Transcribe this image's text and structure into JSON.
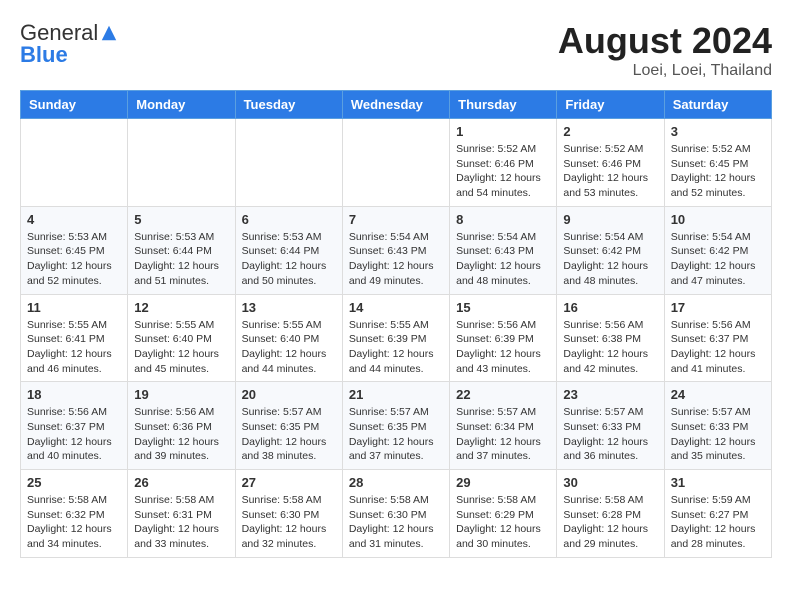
{
  "header": {
    "logo_general": "General",
    "logo_blue": "Blue",
    "title": "August 2024",
    "location": "Loei, Loei, Thailand"
  },
  "days_of_week": [
    "Sunday",
    "Monday",
    "Tuesday",
    "Wednesday",
    "Thursday",
    "Friday",
    "Saturday"
  ],
  "weeks": [
    [
      {
        "day": "",
        "info": ""
      },
      {
        "day": "",
        "info": ""
      },
      {
        "day": "",
        "info": ""
      },
      {
        "day": "",
        "info": ""
      },
      {
        "day": "1",
        "info": "Sunrise: 5:52 AM\nSunset: 6:46 PM\nDaylight: 12 hours\nand 54 minutes."
      },
      {
        "day": "2",
        "info": "Sunrise: 5:52 AM\nSunset: 6:46 PM\nDaylight: 12 hours\nand 53 minutes."
      },
      {
        "day": "3",
        "info": "Sunrise: 5:52 AM\nSunset: 6:45 PM\nDaylight: 12 hours\nand 52 minutes."
      }
    ],
    [
      {
        "day": "4",
        "info": "Sunrise: 5:53 AM\nSunset: 6:45 PM\nDaylight: 12 hours\nand 52 minutes."
      },
      {
        "day": "5",
        "info": "Sunrise: 5:53 AM\nSunset: 6:44 PM\nDaylight: 12 hours\nand 51 minutes."
      },
      {
        "day": "6",
        "info": "Sunrise: 5:53 AM\nSunset: 6:44 PM\nDaylight: 12 hours\nand 50 minutes."
      },
      {
        "day": "7",
        "info": "Sunrise: 5:54 AM\nSunset: 6:43 PM\nDaylight: 12 hours\nand 49 minutes."
      },
      {
        "day": "8",
        "info": "Sunrise: 5:54 AM\nSunset: 6:43 PM\nDaylight: 12 hours\nand 48 minutes."
      },
      {
        "day": "9",
        "info": "Sunrise: 5:54 AM\nSunset: 6:42 PM\nDaylight: 12 hours\nand 48 minutes."
      },
      {
        "day": "10",
        "info": "Sunrise: 5:54 AM\nSunset: 6:42 PM\nDaylight: 12 hours\nand 47 minutes."
      }
    ],
    [
      {
        "day": "11",
        "info": "Sunrise: 5:55 AM\nSunset: 6:41 PM\nDaylight: 12 hours\nand 46 minutes."
      },
      {
        "day": "12",
        "info": "Sunrise: 5:55 AM\nSunset: 6:40 PM\nDaylight: 12 hours\nand 45 minutes."
      },
      {
        "day": "13",
        "info": "Sunrise: 5:55 AM\nSunset: 6:40 PM\nDaylight: 12 hours\nand 44 minutes."
      },
      {
        "day": "14",
        "info": "Sunrise: 5:55 AM\nSunset: 6:39 PM\nDaylight: 12 hours\nand 44 minutes."
      },
      {
        "day": "15",
        "info": "Sunrise: 5:56 AM\nSunset: 6:39 PM\nDaylight: 12 hours\nand 43 minutes."
      },
      {
        "day": "16",
        "info": "Sunrise: 5:56 AM\nSunset: 6:38 PM\nDaylight: 12 hours\nand 42 minutes."
      },
      {
        "day": "17",
        "info": "Sunrise: 5:56 AM\nSunset: 6:37 PM\nDaylight: 12 hours\nand 41 minutes."
      }
    ],
    [
      {
        "day": "18",
        "info": "Sunrise: 5:56 AM\nSunset: 6:37 PM\nDaylight: 12 hours\nand 40 minutes."
      },
      {
        "day": "19",
        "info": "Sunrise: 5:56 AM\nSunset: 6:36 PM\nDaylight: 12 hours\nand 39 minutes."
      },
      {
        "day": "20",
        "info": "Sunrise: 5:57 AM\nSunset: 6:35 PM\nDaylight: 12 hours\nand 38 minutes."
      },
      {
        "day": "21",
        "info": "Sunrise: 5:57 AM\nSunset: 6:35 PM\nDaylight: 12 hours\nand 37 minutes."
      },
      {
        "day": "22",
        "info": "Sunrise: 5:57 AM\nSunset: 6:34 PM\nDaylight: 12 hours\nand 37 minutes."
      },
      {
        "day": "23",
        "info": "Sunrise: 5:57 AM\nSunset: 6:33 PM\nDaylight: 12 hours\nand 36 minutes."
      },
      {
        "day": "24",
        "info": "Sunrise: 5:57 AM\nSunset: 6:33 PM\nDaylight: 12 hours\nand 35 minutes."
      }
    ],
    [
      {
        "day": "25",
        "info": "Sunrise: 5:58 AM\nSunset: 6:32 PM\nDaylight: 12 hours\nand 34 minutes."
      },
      {
        "day": "26",
        "info": "Sunrise: 5:58 AM\nSunset: 6:31 PM\nDaylight: 12 hours\nand 33 minutes."
      },
      {
        "day": "27",
        "info": "Sunrise: 5:58 AM\nSunset: 6:30 PM\nDaylight: 12 hours\nand 32 minutes."
      },
      {
        "day": "28",
        "info": "Sunrise: 5:58 AM\nSunset: 6:30 PM\nDaylight: 12 hours\nand 31 minutes."
      },
      {
        "day": "29",
        "info": "Sunrise: 5:58 AM\nSunset: 6:29 PM\nDaylight: 12 hours\nand 30 minutes."
      },
      {
        "day": "30",
        "info": "Sunrise: 5:58 AM\nSunset: 6:28 PM\nDaylight: 12 hours\nand 29 minutes."
      },
      {
        "day": "31",
        "info": "Sunrise: 5:59 AM\nSunset: 6:27 PM\nDaylight: 12 hours\nand 28 minutes."
      }
    ]
  ]
}
